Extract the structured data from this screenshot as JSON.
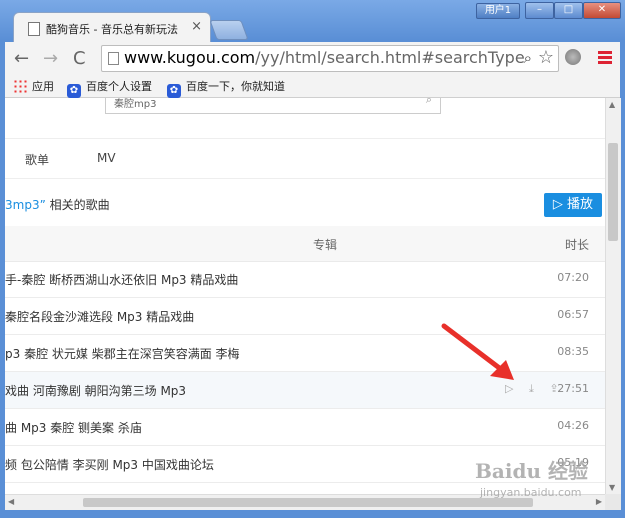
{
  "window": {
    "tab_title": "酷狗音乐 - 音乐总有新玩法",
    "tab_close": "×",
    "user_label": "用户1",
    "buttons": {
      "minimize": "–",
      "maximize": "□",
      "close": "✕"
    }
  },
  "toolbar": {
    "back": "←",
    "forward": "→",
    "reload": "C",
    "url_host": "www.kugou.com",
    "url_path": "/yy/html/search.html#searchType=sc",
    "search_glyph": "⌕",
    "star_glyph": "☆"
  },
  "bookmarks": [
    {
      "label": "应用",
      "icon": "apps-icon"
    },
    {
      "label": "百度个人设置",
      "icon": "baidu-paw-icon"
    },
    {
      "label": "百度一下，你就知道",
      "icon": "baidu-paw-icon"
    }
  ],
  "page": {
    "search_query": "秦腔mp3",
    "tabs": [
      "歌单",
      "MV"
    ],
    "results_text_prefix": "3mp3”",
    "results_text_suffix": " 相关的歌曲",
    "play_button": "▷ 播放",
    "col_album": "专辑",
    "col_duration": "时长",
    "rows": [
      {
        "title": "手-秦腔 断桥西湖山水还依旧 Mp3 精品戏曲",
        "duration": "07:20"
      },
      {
        "title": " 秦腔名段金沙滩选段 Mp3 精品戏曲",
        "duration": "06:57"
      },
      {
        "title": "p3 秦腔 状元媒 柴郡主在深宫笑容满面 李梅",
        "duration": "08:35"
      },
      {
        "title": "戏曲 河南豫剧 朝阳沟第三场 Mp3",
        "duration": "27:51"
      },
      {
        "title": "曲 Mp3 秦腔 铡美案 杀庙",
        "duration": "04:26"
      },
      {
        "title": "频 包公陪情 李买刚 Mp3 中国戏曲论坛",
        "duration": "05:19"
      }
    ],
    "row_actions": "▷ ⤓ ⇪"
  },
  "watermark": {
    "main": "Baidu 经验",
    "sub": "jingyan.baidu.com"
  },
  "colors": {
    "accent": "#1a8ee0",
    "frame": "#5a8fd6",
    "arrow": "#e8302a"
  }
}
